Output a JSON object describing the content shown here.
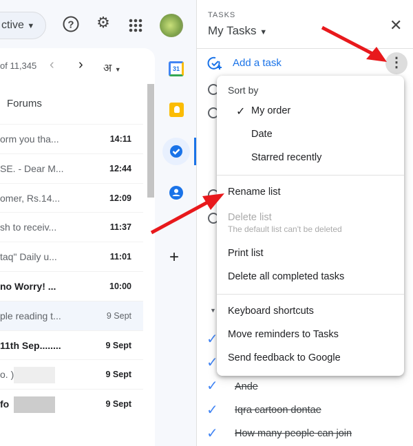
{
  "header": {
    "search_chip": "ctive",
    "avatar": "profile-avatar"
  },
  "toolbar": {
    "count": "of 11,345",
    "lang": "अ"
  },
  "inbox": {
    "category": "Forums",
    "rows": [
      {
        "snippet": "orm you tha...",
        "time": "14:11",
        "bold": false
      },
      {
        "snippet": "SE. - Dear M...",
        "time": "12:44",
        "bold": false
      },
      {
        "snippet": "omer, Rs.14...",
        "time": "12:09",
        "bold": false
      },
      {
        "snippet": "sh to receiv...",
        "time": "11:37",
        "bold": false
      },
      {
        "snippet": "taq\" Daily u...",
        "time": "11:01",
        "bold": false
      },
      {
        "snippet": "no Worry! ...",
        "time": "10:00",
        "bold": true
      },
      {
        "snippet": "ple reading t...",
        "time": "9 Sept",
        "bold": false
      },
      {
        "snippet": "11th Sep........",
        "time": "9 Sept",
        "bold": true
      },
      {
        "snippet": "o. )",
        "time": "9 Sept",
        "bold": false
      },
      {
        "snippet": "fo",
        "time": "9 Sept",
        "bold": true
      }
    ]
  },
  "side": {
    "calendar_day": "31"
  },
  "tasks": {
    "heading": "TASKS",
    "list_name": "My Tasks",
    "add_task": "Add a task",
    "completed": [
      "Ande",
      "Iqra cartoon dontae",
      "How many people can join"
    ]
  },
  "menu": {
    "sort_by": "Sort by",
    "my_order": "My order",
    "date": "Date",
    "starred": "Starred recently",
    "rename": "Rename list",
    "delete": "Delete list",
    "delete_note": "The default list can't be deleted",
    "print": "Print list",
    "delete_completed": "Delete all completed tasks",
    "shortcuts": "Keyboard shortcuts",
    "move_reminders": "Move reminders to Tasks",
    "feedback": "Send feedback to Google"
  },
  "colors": {
    "accent": "#1a73e8",
    "arrow": "#e8191c"
  }
}
